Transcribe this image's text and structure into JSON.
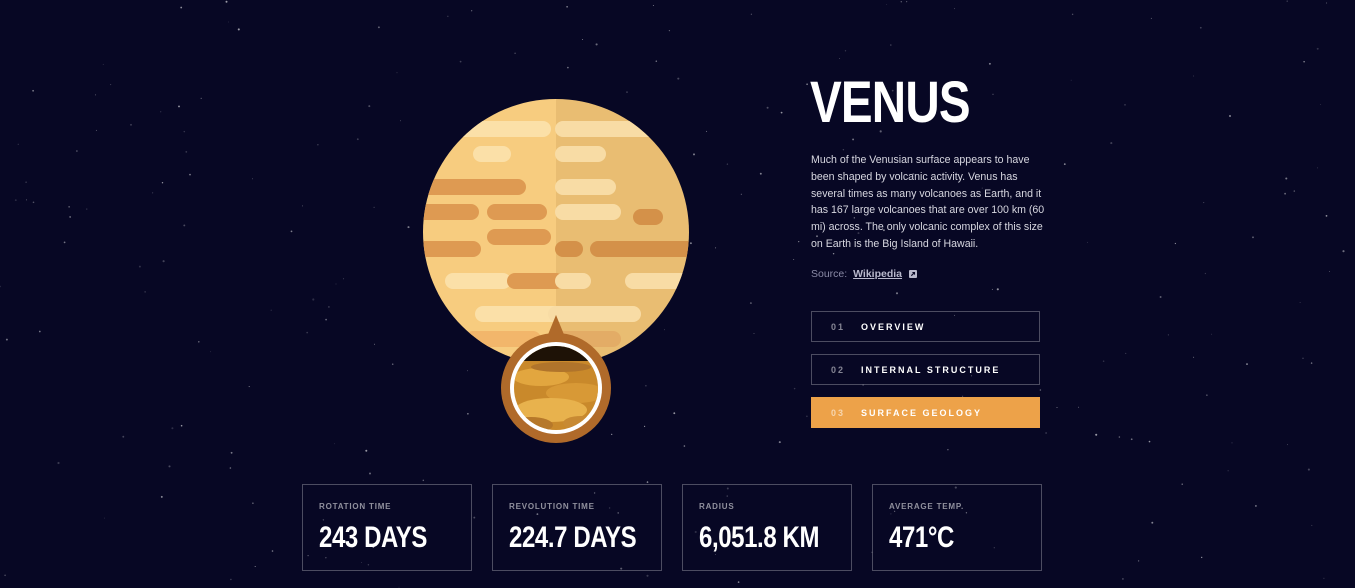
{
  "planet": {
    "name": "VENUS",
    "description": "Much of the Venusian surface appears to have been shaped by volcanic activity. Venus has several times as many volcanoes as Earth, and it has 167 large volcanoes that are over 100 km (60 mi) across. The only volcanic complex of this size on Earth is the Big Island of Hawaii.",
    "source_label": "Source:",
    "source_link": "Wikipedia",
    "source_icon": "external-link-icon"
  },
  "tabs": [
    {
      "num": "01",
      "label": "OVERVIEW",
      "active": false
    },
    {
      "num": "02",
      "label": "INTERNAL STRUCTURE",
      "active": false
    },
    {
      "num": "03",
      "label": "SURFACE GEOLOGY",
      "active": true
    }
  ],
  "stats": [
    {
      "label": "ROTATION TIME",
      "value": "243 DAYS"
    },
    {
      "label": "REVOLUTION TIME",
      "value": "224.7 DAYS"
    },
    {
      "label": "RADIUS",
      "value": "6,051.8 KM"
    },
    {
      "label": "AVERAGE TEMP.",
      "value": "471°C"
    }
  ],
  "colors": {
    "background": "#070724",
    "accent": "#EDA249",
    "planet_light": "#F7CC7F",
    "planet_shadow": "#E9BD72",
    "geology_ring": "#B06A2A"
  }
}
